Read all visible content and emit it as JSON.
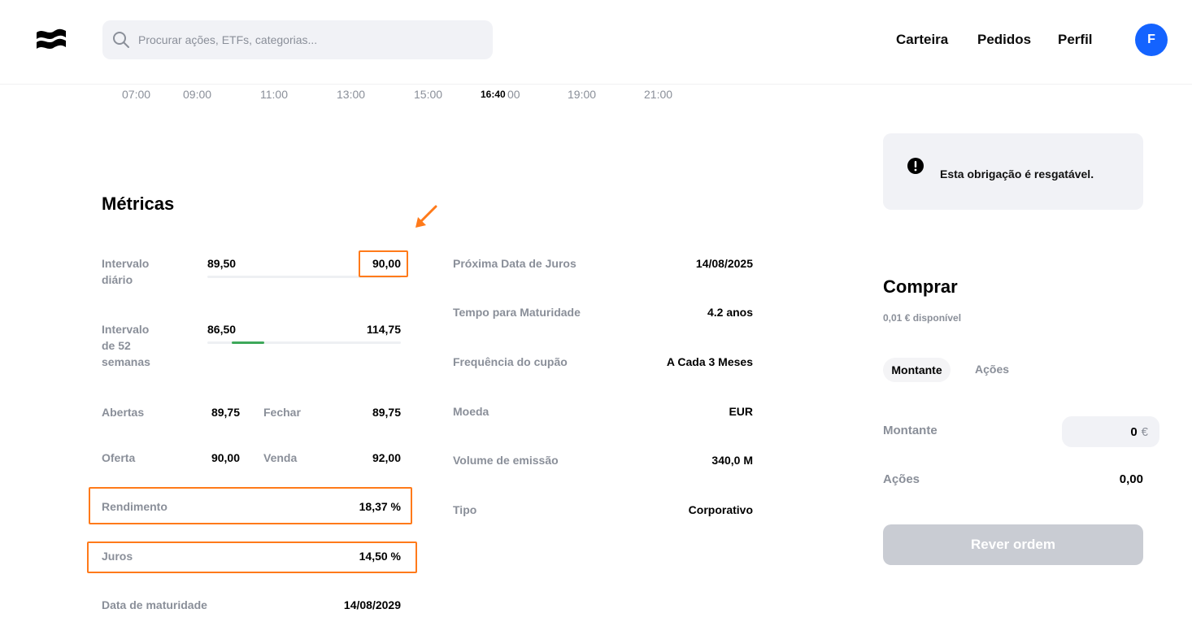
{
  "header": {
    "search_placeholder": "Procurar ações, ETFs, categorias...",
    "nav": [
      "Carteira",
      "Pedidos",
      "Perfil"
    ],
    "avatar_initial": "F",
    "brand_color": "#1463ff"
  },
  "time_axis": {
    "ticks": [
      "07:00",
      "09:00",
      "11:00",
      "13:00",
      "15:00",
      "19:00",
      "21:00"
    ],
    "current": "16:40",
    "hidden_tick_fragment": "00"
  },
  "metrics": {
    "title": "Métricas",
    "daily_range": {
      "label_line1": "Intervalo",
      "label_line2": "diário",
      "low": "89,50",
      "high": "90,00"
    },
    "week52_range": {
      "label_line1": "Intervalo",
      "label_line2": "de 52",
      "label_line3": "semanas",
      "low": "86,50",
      "high": "114,75",
      "current_fraction": 0.15
    },
    "open": {
      "label": "Abertas",
      "value": "89,75"
    },
    "close": {
      "label": "Fechar",
      "value": "89,75"
    },
    "bid": {
      "label": "Oferta",
      "value": "90,00"
    },
    "ask": {
      "label": "Venda",
      "value": "92,00"
    },
    "yield": {
      "label": "Rendimento",
      "value": "18,37 %"
    },
    "interest": {
      "label": "Juros",
      "value": "14,50 %"
    },
    "maturity": {
      "label": "Data de maturidade",
      "value": "14/08/2029"
    },
    "right": [
      {
        "label": "Próxima Data de Juros",
        "value": "14/08/2025"
      },
      {
        "label": "Tempo para Maturidade",
        "value": "4.2 anos"
      },
      {
        "label": "Frequência do cupão",
        "value": "A Cada 3 Meses"
      },
      {
        "label": "Moeda",
        "value": "EUR"
      },
      {
        "label": "Volume de emissão",
        "value": "340,0 M"
      },
      {
        "label": "Tipo",
        "value": "Corporativo"
      }
    ]
  },
  "alert": {
    "text": "Esta obrigação é resgatável."
  },
  "buy": {
    "title": "Comprar",
    "available": "0,01 € disponível",
    "tabs": [
      "Montante",
      "Ações"
    ],
    "amount_label": "Montante",
    "amount_value": "0",
    "currency": "€",
    "shares_label": "Ações",
    "shares_value": "0,00",
    "review_button": "Rever ordem"
  },
  "annotation_color": "#ff7a1a"
}
